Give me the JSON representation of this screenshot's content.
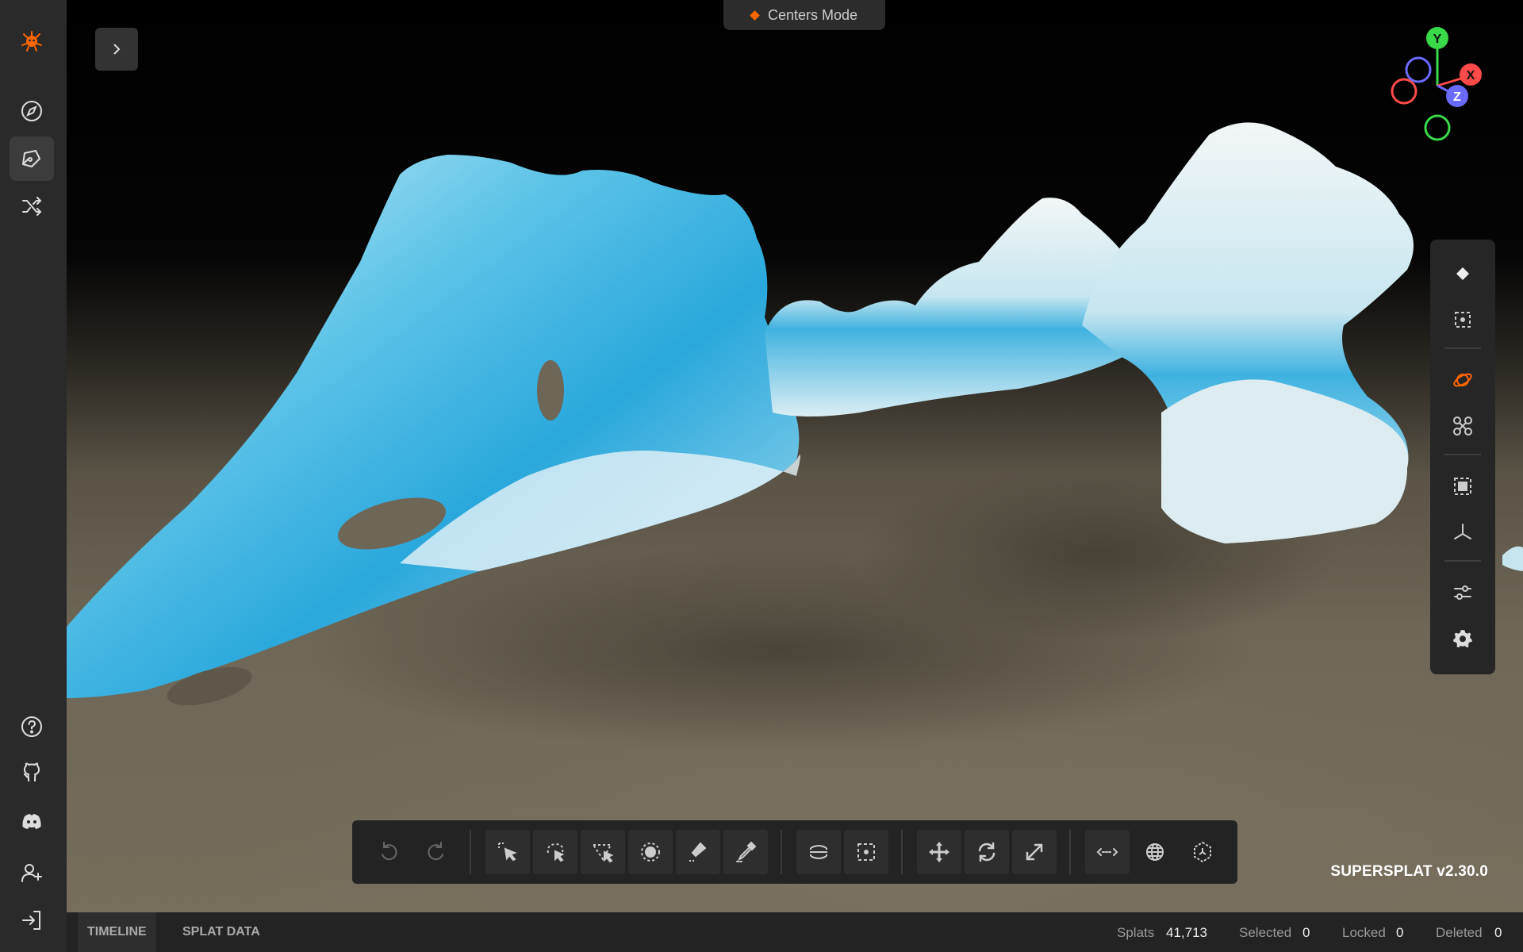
{
  "sidebar": {
    "top": [
      {
        "name": "logo",
        "icon": "supersplat-logo-icon"
      },
      {
        "name": "explore",
        "icon": "compass-icon"
      },
      {
        "name": "editor",
        "icon": "pen-tool-icon",
        "active": true
      },
      {
        "name": "shuffle",
        "icon": "shuffle-icon"
      }
    ],
    "bottom": [
      {
        "name": "help",
        "icon": "help-circle-icon"
      },
      {
        "name": "github",
        "icon": "github-icon"
      },
      {
        "name": "discord",
        "icon": "discord-icon"
      },
      {
        "name": "add-user",
        "icon": "user-plus-icon"
      },
      {
        "name": "login",
        "icon": "log-in-icon"
      }
    ]
  },
  "viewport": {
    "mode_label": "Centers Mode",
    "version": "SUPERSPLAT v2.30.0",
    "gizmo": {
      "x": "X",
      "y": "Y",
      "z": "Z",
      "x_color": "#ff4a4a",
      "y_color": "#39d94a",
      "z_color": "#6a6aff"
    }
  },
  "right_toolbar": [
    "centers-mode-icon",
    "rings-mode-icon",
    "orbit-camera-icon",
    "fly-camera-icon",
    "frame-selection-icon",
    "reset-camera-icon",
    "view-options-icon",
    "settings-icon"
  ],
  "bottom_toolbar": [
    "undo-icon",
    "redo-icon",
    "picker-select-icon",
    "lasso-select-icon",
    "polygon-select-icon",
    "brush-select-icon",
    "flood-select-icon",
    "eyedropper-select-icon",
    "sphere-select-icon",
    "box-select-icon",
    "move-icon",
    "rotate-icon",
    "scale-icon",
    "measure-icon",
    "world-space-icon",
    "pivot-icon"
  ],
  "statusbar": {
    "tabs": [
      "TIMELINE",
      "SPLAT DATA"
    ],
    "splats_label": "Splats",
    "splats": "41,713",
    "selected_label": "Selected",
    "selected": "0",
    "locked_label": "Locked",
    "locked": "0",
    "deleted_label": "Deleted",
    "deleted": "0"
  },
  "colors": {
    "accent": "#ff6600",
    "sidebar_bg": "#2a2a2a",
    "toolbar_bg": "#232323"
  }
}
